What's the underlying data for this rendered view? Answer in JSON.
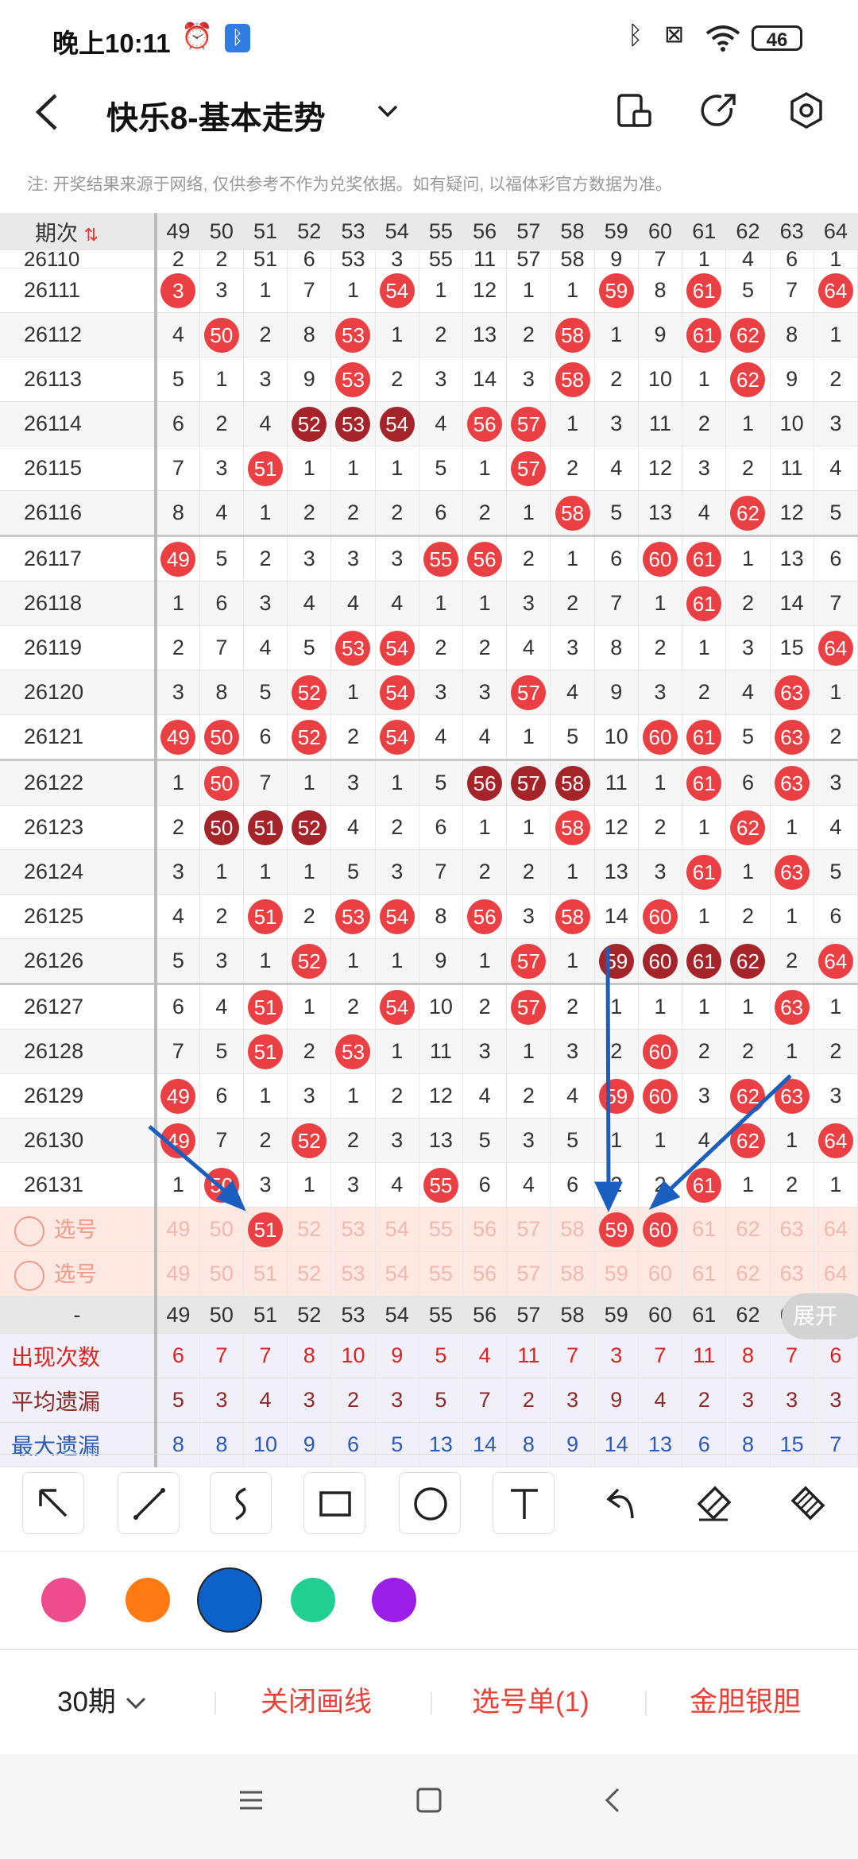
{
  "status_bar": {
    "time": "晚上10:11",
    "battery": "46",
    "icons": [
      "alarm-icon",
      "bluetooth-app-icon",
      "bluetooth-icon",
      "sim-off-icon",
      "wifi-icon",
      "battery-icon"
    ]
  },
  "header": {
    "title": "快乐8-基本走势",
    "icons": [
      "back-icon",
      "dropdown-chevron-icon",
      "device-switch-icon",
      "share-icon",
      "settings-icon"
    ]
  },
  "note": "注: 开奖结果来源于网络, 仅供参考不作为兑奖依据。如有疑问, 以福体彩官方数据为准。",
  "table": {
    "period_header": "期次",
    "numbers": [
      "49",
      "50",
      "51",
      "52",
      "53",
      "54",
      "55",
      "56",
      "57",
      "58",
      "59",
      "60",
      "61",
      "62",
      "63",
      "64"
    ],
    "partial_row": [
      "2",
      "2",
      "51",
      "6",
      "53",
      "3",
      "55",
      "11",
      "57",
      "58",
      "9",
      "7",
      "1",
      "4",
      "6",
      "1"
    ],
    "partial_period": "26110",
    "rows": [
      {
        "period": "26111",
        "cells": [
          "3",
          "3",
          "1",
          "7",
          "1",
          "54",
          "1",
          "12",
          "1",
          "1",
          "59",
          "8",
          "61",
          "5",
          "7",
          "64"
        ],
        "hits": [
          "r",
          "",
          "",
          "",
          "",
          "r",
          "",
          "",
          "",
          "",
          "r",
          "",
          "r",
          "",
          "",
          "r"
        ]
      },
      {
        "period": "26112",
        "cells": [
          "4",
          "50",
          "2",
          "8",
          "53",
          "1",
          "2",
          "13",
          "2",
          "58",
          "1",
          "9",
          "61",
          "62",
          "8",
          "1"
        ],
        "hits": [
          "",
          "r",
          "",
          "",
          "r",
          "",
          "",
          "",
          "",
          "r",
          "",
          "",
          "r",
          "r",
          "",
          ""
        ]
      },
      {
        "period": "26113",
        "cells": [
          "5",
          "1",
          "3",
          "9",
          "53",
          "2",
          "3",
          "14",
          "3",
          "58",
          "2",
          "10",
          "1",
          "62",
          "9",
          "2"
        ],
        "hits": [
          "",
          "",
          "",
          "",
          "r",
          "",
          "",
          "",
          "",
          "r",
          "",
          "",
          "",
          "r",
          "",
          ""
        ]
      },
      {
        "period": "26114",
        "cells": [
          "6",
          "2",
          "4",
          "52",
          "53",
          "54",
          "4",
          "56",
          "57",
          "1",
          "3",
          "11",
          "2",
          "1",
          "10",
          "3"
        ],
        "hits": [
          "",
          "",
          "",
          "d",
          "d",
          "d",
          "",
          "r",
          "r",
          "",
          "",
          "",
          "",
          "",
          "",
          ""
        ]
      },
      {
        "period": "26115",
        "cells": [
          "7",
          "3",
          "51",
          "1",
          "1",
          "1",
          "5",
          "1",
          "57",
          "2",
          "4",
          "12",
          "3",
          "2",
          "11",
          "4"
        ],
        "hits": [
          "",
          "",
          "r",
          "",
          "",
          "",
          "",
          "",
          "r",
          "",
          "",
          "",
          "",
          "",
          "",
          ""
        ]
      },
      {
        "period": "26116",
        "cells": [
          "8",
          "4",
          "1",
          "2",
          "2",
          "2",
          "6",
          "2",
          "1",
          "58",
          "5",
          "13",
          "4",
          "62",
          "12",
          "5"
        ],
        "hits": [
          "",
          "",
          "",
          "",
          "",
          "",
          "",
          "",
          "",
          "r",
          "",
          "",
          "",
          "r",
          "",
          ""
        ]
      },
      {
        "period": "26117",
        "cells": [
          "49",
          "5",
          "2",
          "3",
          "3",
          "3",
          "55",
          "56",
          "2",
          "1",
          "6",
          "60",
          "61",
          "1",
          "13",
          "6"
        ],
        "hits": [
          "r",
          "",
          "",
          "",
          "",
          "",
          "r",
          "r",
          "",
          "",
          "",
          "r",
          "r",
          "",
          "",
          ""
        ]
      },
      {
        "period": "26118",
        "cells": [
          "1",
          "6",
          "3",
          "4",
          "4",
          "4",
          "1",
          "1",
          "3",
          "2",
          "7",
          "1",
          "61",
          "2",
          "14",
          "7"
        ],
        "hits": [
          "",
          "",
          "",
          "",
          "",
          "",
          "",
          "",
          "",
          "",
          "",
          "",
          "r",
          "",
          "",
          ""
        ]
      },
      {
        "period": "26119",
        "cells": [
          "2",
          "7",
          "4",
          "5",
          "53",
          "54",
          "2",
          "2",
          "4",
          "3",
          "8",
          "2",
          "1",
          "3",
          "15",
          "64"
        ],
        "hits": [
          "",
          "",
          "",
          "",
          "r",
          "r",
          "",
          "",
          "",
          "",
          "",
          "",
          "",
          "",
          "",
          "r"
        ]
      },
      {
        "period": "26120",
        "cells": [
          "3",
          "8",
          "5",
          "52",
          "1",
          "54",
          "3",
          "3",
          "57",
          "4",
          "9",
          "3",
          "2",
          "4",
          "63",
          "1"
        ],
        "hits": [
          "",
          "",
          "",
          "r",
          "",
          "r",
          "",
          "",
          "r",
          "",
          "",
          "",
          "",
          "",
          "r",
          ""
        ]
      },
      {
        "period": "26121",
        "cells": [
          "49",
          "50",
          "6",
          "52",
          "2",
          "54",
          "4",
          "4",
          "1",
          "5",
          "10",
          "60",
          "61",
          "5",
          "63",
          "2"
        ],
        "hits": [
          "r",
          "r",
          "",
          "r",
          "",
          "r",
          "",
          "",
          "",
          "",
          "",
          "r",
          "r",
          "",
          "r",
          ""
        ]
      },
      {
        "period": "26122",
        "cells": [
          "1",
          "50",
          "7",
          "1",
          "3",
          "1",
          "5",
          "56",
          "57",
          "58",
          "11",
          "1",
          "61",
          "6",
          "63",
          "3"
        ],
        "hits": [
          "",
          "r",
          "",
          "",
          "",
          "",
          "",
          "d",
          "d",
          "d",
          "",
          "",
          "r",
          "",
          "r",
          ""
        ]
      },
      {
        "period": "26123",
        "cells": [
          "2",
          "50",
          "51",
          "52",
          "4",
          "2",
          "6",
          "1",
          "1",
          "58",
          "12",
          "2",
          "1",
          "62",
          "1",
          "4"
        ],
        "hits": [
          "",
          "d",
          "d",
          "d",
          "",
          "",
          "",
          "",
          "",
          "r",
          "",
          "",
          "",
          "r",
          "",
          ""
        ]
      },
      {
        "period": "26124",
        "cells": [
          "3",
          "1",
          "1",
          "1",
          "5",
          "3",
          "7",
          "2",
          "2",
          "1",
          "13",
          "3",
          "61",
          "1",
          "63",
          "5"
        ],
        "hits": [
          "",
          "",
          "",
          "",
          "",
          "",
          "",
          "",
          "",
          "",
          "",
          "",
          "r",
          "",
          "r",
          ""
        ]
      },
      {
        "period": "26125",
        "cells": [
          "4",
          "2",
          "51",
          "2",
          "53",
          "54",
          "8",
          "56",
          "3",
          "58",
          "14",
          "60",
          "1",
          "2",
          "1",
          "6"
        ],
        "hits": [
          "",
          "",
          "r",
          "",
          "r",
          "r",
          "",
          "r",
          "",
          "r",
          "",
          "r",
          "",
          "",
          "",
          ""
        ]
      },
      {
        "period": "26126",
        "cells": [
          "5",
          "3",
          "1",
          "52",
          "1",
          "1",
          "9",
          "1",
          "57",
          "1",
          "59",
          "60",
          "61",
          "62",
          "2",
          "64"
        ],
        "hits": [
          "",
          "",
          "",
          "r",
          "",
          "",
          "",
          "",
          "r",
          "",
          "d",
          "d",
          "d",
          "d",
          "",
          "r"
        ]
      },
      {
        "period": "26127",
        "cells": [
          "6",
          "4",
          "51",
          "1",
          "2",
          "54",
          "10",
          "2",
          "57",
          "2",
          "1",
          "1",
          "1",
          "1",
          "63",
          "1"
        ],
        "hits": [
          "",
          "",
          "r",
          "",
          "",
          "r",
          "",
          "",
          "r",
          "",
          "",
          "",
          "",
          "",
          "r",
          ""
        ]
      },
      {
        "period": "26128",
        "cells": [
          "7",
          "5",
          "51",
          "2",
          "53",
          "1",
          "11",
          "3",
          "1",
          "3",
          "2",
          "60",
          "2",
          "2",
          "1",
          "2"
        ],
        "hits": [
          "",
          "",
          "r",
          "",
          "r",
          "",
          "",
          "",
          "",
          "",
          "",
          "r",
          "",
          "",
          "",
          ""
        ]
      },
      {
        "period": "26129",
        "cells": [
          "49",
          "6",
          "1",
          "3",
          "1",
          "2",
          "12",
          "4",
          "2",
          "4",
          "59",
          "60",
          "3",
          "62",
          "63",
          "3"
        ],
        "hits": [
          "r",
          "",
          "",
          "",
          "",
          "",
          "",
          "",
          "",
          "",
          "r",
          "r",
          "",
          "r",
          "r",
          ""
        ]
      },
      {
        "period": "26130",
        "cells": [
          "49",
          "7",
          "2",
          "52",
          "2",
          "3",
          "13",
          "5",
          "3",
          "5",
          "1",
          "1",
          "4",
          "62",
          "1",
          "64"
        ],
        "hits": [
          "r",
          "",
          "",
          "r",
          "",
          "",
          "",
          "",
          "",
          "",
          "",
          "",
          "",
          "r",
          "",
          "r"
        ]
      },
      {
        "period": "26131",
        "cells": [
          "1",
          "50",
          "3",
          "1",
          "3",
          "4",
          "55",
          "6",
          "4",
          "6",
          "2",
          "2",
          "61",
          "1",
          "2",
          "1"
        ],
        "hits": [
          "",
          "r",
          "",
          "",
          "",
          "",
          "r",
          "",
          "",
          "",
          "",
          "",
          "r",
          "",
          "",
          ""
        ]
      }
    ],
    "selection_rows": [
      {
        "label": "选号",
        "hits": [
          "",
          "",
          "r",
          "",
          "",
          "",
          "",
          "",
          "",
          "",
          "r",
          "r",
          "",
          "",
          "",
          ""
        ]
      },
      {
        "label": "选号",
        "hits": [
          "",
          "",
          "",
          "",
          "",
          "",
          "",
          "",
          "",
          "",
          "",
          "",
          "",
          "",
          "",
          ""
        ]
      }
    ],
    "stats_header": "-",
    "stats": [
      {
        "label": "出现次数",
        "values": [
          "6",
          "7",
          "7",
          "8",
          "10",
          "9",
          "5",
          "4",
          "11",
          "7",
          "3",
          "7",
          "11",
          "8",
          "7",
          "6"
        ]
      },
      {
        "label": "平均遗漏",
        "values": [
          "5",
          "3",
          "4",
          "3",
          "2",
          "3",
          "5",
          "7",
          "2",
          "3",
          "9",
          "4",
          "2",
          "3",
          "3",
          "3"
        ]
      },
      {
        "label": "最大遗漏",
        "values": [
          "8",
          "8",
          "10",
          "9",
          "6",
          "5",
          "13",
          "14",
          "8",
          "9",
          "14",
          "13",
          "6",
          "8",
          "15",
          "7"
        ]
      }
    ],
    "expand_label": "展开"
  },
  "colors": {
    "hit": "#ea3f43",
    "hit_dark": "#a4242a",
    "arrow": "#1a5fc0"
  },
  "draw_tools": [
    "arrow-tool-icon",
    "line-tool-icon",
    "curve-tool-icon",
    "rectangle-tool-icon",
    "circle-tool-icon",
    "text-tool-icon",
    "undo-icon",
    "eraser-icon",
    "clear-brush-icon"
  ],
  "palette": [
    {
      "name": "pink",
      "hex": "#ee4c8d"
    },
    {
      "name": "orange",
      "hex": "#ff7a12"
    },
    {
      "name": "blue",
      "hex": "#0c62c9",
      "selected": true
    },
    {
      "name": "green",
      "hex": "#22cf93"
    },
    {
      "name": "purple",
      "hex": "#9a1ee8"
    }
  ],
  "bottom": {
    "period_select": "30期",
    "close_lines": "关闭画线",
    "pick_list": "选号单(1)",
    "gold_silver": "金胆银胆"
  }
}
